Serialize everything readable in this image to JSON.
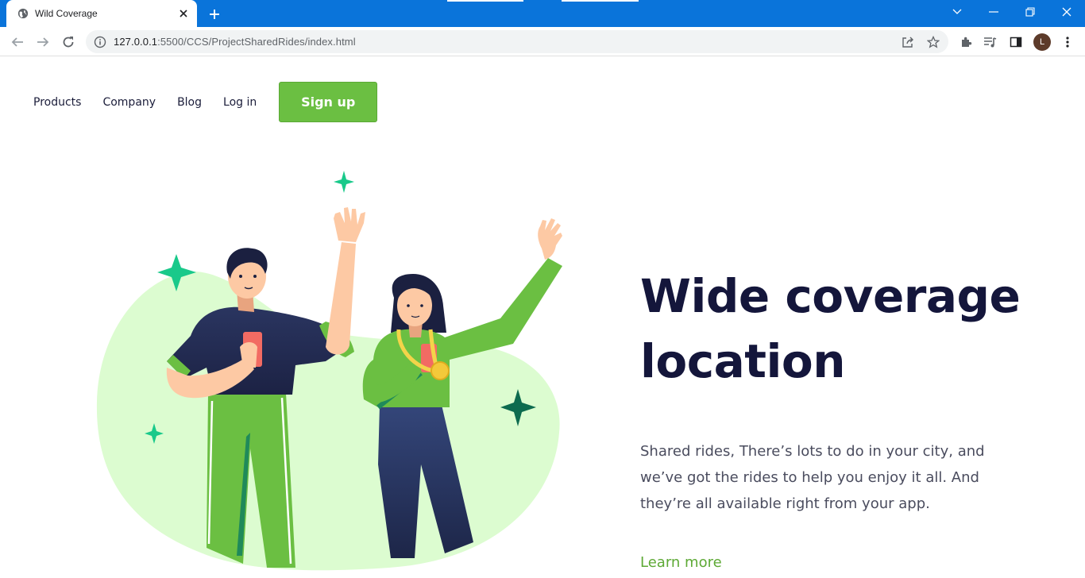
{
  "browser": {
    "tab_title": "Wild Coverage",
    "url_host": "127.0.0.1",
    "url_rest": ":5500/CCS/ProjectSharedRides/index.html",
    "avatar_letter": "L",
    "accent_color": "#0a74da"
  },
  "nav": {
    "links": [
      "Products",
      "Company",
      "Blog",
      "Log in"
    ],
    "signup_label": "Sign up"
  },
  "hero": {
    "title_line1": "Wide coverage",
    "title_line2": "location",
    "description": "Shared rides, There’s lots to do in your city, and we’ve got the rides to help you enjoy it all. And they’re all available right from your app.",
    "cta": "Learn more"
  },
  "colors": {
    "brand_green": "#6bbf42",
    "title_navy": "#14163b",
    "blob_green": "#dcfcd0",
    "sparkle_green": "#19c98a",
    "sparkle_dark": "#0d6b4f"
  },
  "icons": [
    "globe-icon",
    "close-icon",
    "plus-icon",
    "back-icon",
    "forward-icon",
    "reload-icon",
    "info-icon",
    "share-icon",
    "star-icon",
    "extensions-icon",
    "media-icon",
    "sidepanel-icon",
    "menu-icon"
  ]
}
